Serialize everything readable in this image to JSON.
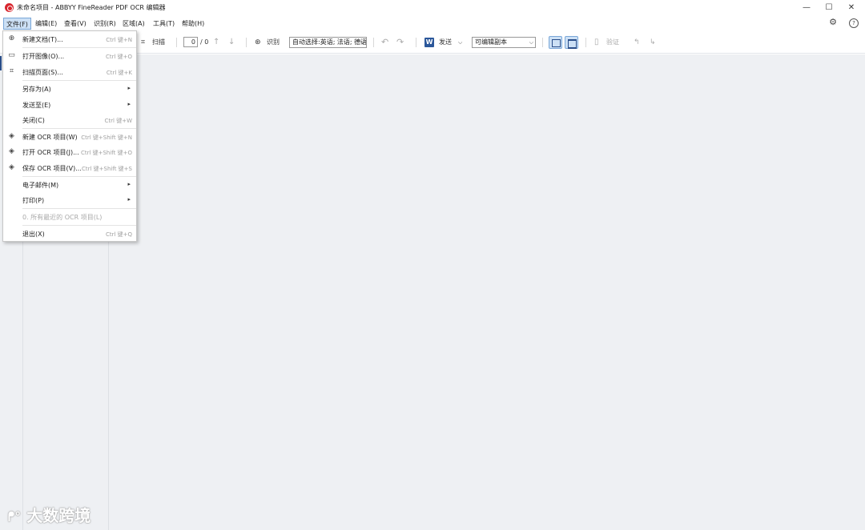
{
  "window": {
    "title": "未命名项目 - ABBYY FineReader PDF OCR 编辑器",
    "minimize": "—",
    "maximize": "☐",
    "close": "✕"
  },
  "menubar": {
    "items": [
      "文件(F)",
      "编辑(E)",
      "查看(V)",
      "识别(R)",
      "区域(A)",
      "工具(T)",
      "帮助(H)"
    ],
    "settings_icon": "⚙",
    "help_icon": "?"
  },
  "toolbar": {
    "scan_label": "扫描",
    "page_current": "0",
    "page_total": "/ 0",
    "recognize_label": "识别",
    "language": "自动选择:英语; 法语; 德语",
    "send_label": "发送",
    "output_format": "可编辑副本",
    "verify_label": "验证",
    "up_arrow": "↑",
    "down_arrow": "↓",
    "undo": "↶",
    "redo": "↷"
  },
  "file_menu": {
    "items": [
      {
        "label": "新建文档(T)...",
        "shortcut": "Ctrl 键+N",
        "icon": "⊕"
      },
      {
        "label": "打开图像(O)...",
        "shortcut": "Ctrl 键+O",
        "icon": "▭"
      },
      {
        "label": "扫描页面(S)...",
        "shortcut": "Ctrl 键+K",
        "icon": "⌗"
      },
      {
        "label": "另存为(A)",
        "arrow": "▸"
      },
      {
        "label": "发送至(E)",
        "arrow": "▸"
      },
      {
        "label": "关闭(C)",
        "shortcut": "Ctrl 键+W"
      },
      {
        "label": "新建 OCR 项目(W)",
        "shortcut": "Ctrl 键+Shift 键+N",
        "icon": "◈"
      },
      {
        "label": "打开 OCR 项目(J)...",
        "shortcut": "Ctrl 键+Shift 键+O",
        "icon": "◈"
      },
      {
        "label": "保存 OCR 项目(V)...",
        "shortcut": "Ctrl 键+Shift 键+S",
        "icon": "◈"
      },
      {
        "label": "电子邮件(M)",
        "arrow": "▸"
      },
      {
        "label": "打印(P)",
        "arrow": "▸"
      },
      {
        "label": "0. 所有最近的 OCR 项目(L)"
      },
      {
        "label": "退出(X)",
        "shortcut": "Ctrl 键+Q"
      }
    ]
  },
  "watermark": "大数跨境",
  "colors": {
    "menu_highlight": "#cce0f5",
    "workspace_bg": "#eef0f3",
    "app_icon": "#d8262e",
    "word_icon": "#2b579a"
  }
}
